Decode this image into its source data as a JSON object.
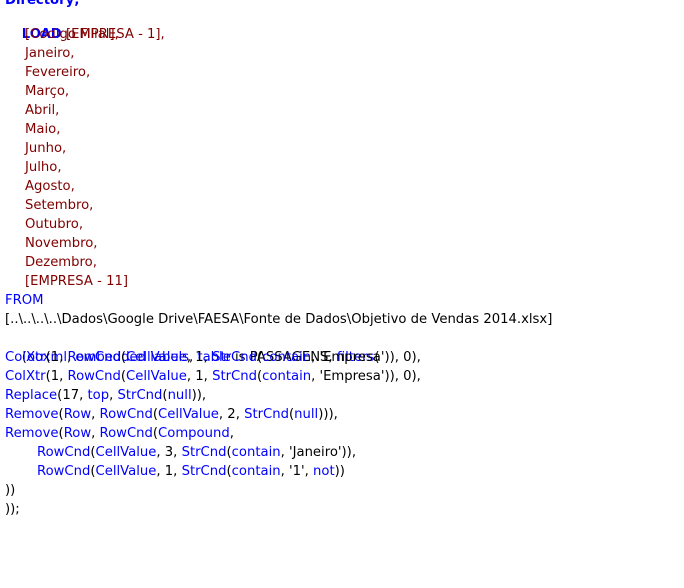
{
  "script": {
    "partial_top_line": "Directory;",
    "load_keyword": "LOAD",
    "fields": [
      "[EMPRESA - 1],",
      "[Codigo Filial],",
      "Janeiro,",
      "Fevereiro,",
      "Março,",
      "Abril,",
      "Maio,",
      "Junho,",
      "Julho,",
      "Agosto,",
      "Setembro,",
      "Outubro,",
      "Novembro,",
      "Dezembro,",
      "[EMPRESA - 11]"
    ],
    "from_keyword": "FROM",
    "source_path": "[..\\..\\..\\..\\Dados\\Google Drive\\FAESA\\Fonte de Dados\\Objetivo de Vendas 2014.xlsx]",
    "format_spec": {
      "open": "(",
      "ooxml": "ooxml",
      "sep1": ", ",
      "embedded_labels": "embedded labels",
      "sep2": ", ",
      "table": "table",
      "is_word": " is PASSAGENS, ",
      "filters": "filters",
      "close": "("
    },
    "filter_lines": [
      [
        {
          "t": "ColXtr",
          "c": "fn"
        },
        {
          "t": "(1, ",
          "c": "txt"
        },
        {
          "t": "RowCnd",
          "c": "fn"
        },
        {
          "t": "(",
          "c": "txt"
        },
        {
          "t": "CellValue",
          "c": "fn"
        },
        {
          "t": ", 1, ",
          "c": "txt"
        },
        {
          "t": "StrCnd",
          "c": "fn"
        },
        {
          "t": "(",
          "c": "txt"
        },
        {
          "t": "contain",
          "c": "fn"
        },
        {
          "t": ", 'Empresa')), 0),",
          "c": "txt"
        }
      ],
      [
        {
          "t": "ColXtr",
          "c": "fn"
        },
        {
          "t": "(1, ",
          "c": "txt"
        },
        {
          "t": "RowCnd",
          "c": "fn"
        },
        {
          "t": "(",
          "c": "txt"
        },
        {
          "t": "CellValue",
          "c": "fn"
        },
        {
          "t": ", 1, ",
          "c": "txt"
        },
        {
          "t": "StrCnd",
          "c": "fn"
        },
        {
          "t": "(",
          "c": "txt"
        },
        {
          "t": "contain",
          "c": "fn"
        },
        {
          "t": ", 'Empresa')), 0),",
          "c": "txt"
        }
      ],
      [
        {
          "t": "Replace",
          "c": "fn"
        },
        {
          "t": "(17, ",
          "c": "txt"
        },
        {
          "t": "top",
          "c": "fn"
        },
        {
          "t": ", ",
          "c": "txt"
        },
        {
          "t": "StrCnd",
          "c": "fn"
        },
        {
          "t": "(",
          "c": "txt"
        },
        {
          "t": "null",
          "c": "fn"
        },
        {
          "t": ")),",
          "c": "txt"
        }
      ],
      [
        {
          "t": "Remove",
          "c": "fn"
        },
        {
          "t": "(",
          "c": "txt"
        },
        {
          "t": "Row",
          "c": "fn"
        },
        {
          "t": ", ",
          "c": "txt"
        },
        {
          "t": "RowCnd",
          "c": "fn"
        },
        {
          "t": "(",
          "c": "txt"
        },
        {
          "t": "CellValue",
          "c": "fn"
        },
        {
          "t": ", 2, ",
          "c": "txt"
        },
        {
          "t": "StrCnd",
          "c": "fn"
        },
        {
          "t": "(",
          "c": "txt"
        },
        {
          "t": "null",
          "c": "fn"
        },
        {
          "t": "))),",
          "c": "txt"
        }
      ],
      [
        {
          "t": "Remove",
          "c": "fn"
        },
        {
          "t": "(",
          "c": "txt"
        },
        {
          "t": "Row",
          "c": "fn"
        },
        {
          "t": ", ",
          "c": "txt"
        },
        {
          "t": "RowCnd",
          "c": "fn"
        },
        {
          "t": "(",
          "c": "txt"
        },
        {
          "t": "Compound",
          "c": "fn"
        },
        {
          "t": ",",
          "c": "txt"
        }
      ]
    ],
    "compound_lines": [
      [
        {
          "t": "RowCnd",
          "c": "fn"
        },
        {
          "t": "(",
          "c": "txt"
        },
        {
          "t": "CellValue",
          "c": "fn"
        },
        {
          "t": ", 3, ",
          "c": "txt"
        },
        {
          "t": "StrCnd",
          "c": "fn"
        },
        {
          "t": "(",
          "c": "txt"
        },
        {
          "t": "contain",
          "c": "fn"
        },
        {
          "t": ", 'Janeiro')),",
          "c": "txt"
        }
      ],
      [
        {
          "t": "RowCnd",
          "c": "fn"
        },
        {
          "t": "(",
          "c": "txt"
        },
        {
          "t": "CellValue",
          "c": "fn"
        },
        {
          "t": ", 1, ",
          "c": "txt"
        },
        {
          "t": "StrCnd",
          "c": "fn"
        },
        {
          "t": "(",
          "c": "txt"
        },
        {
          "t": "contain",
          "c": "fn"
        },
        {
          "t": ", '1', ",
          "c": "txt"
        },
        {
          "t": "not",
          "c": "fn"
        },
        {
          "t": "))",
          "c": "txt"
        }
      ]
    ],
    "close_lines": [
      "))",
      "));"
    ]
  }
}
